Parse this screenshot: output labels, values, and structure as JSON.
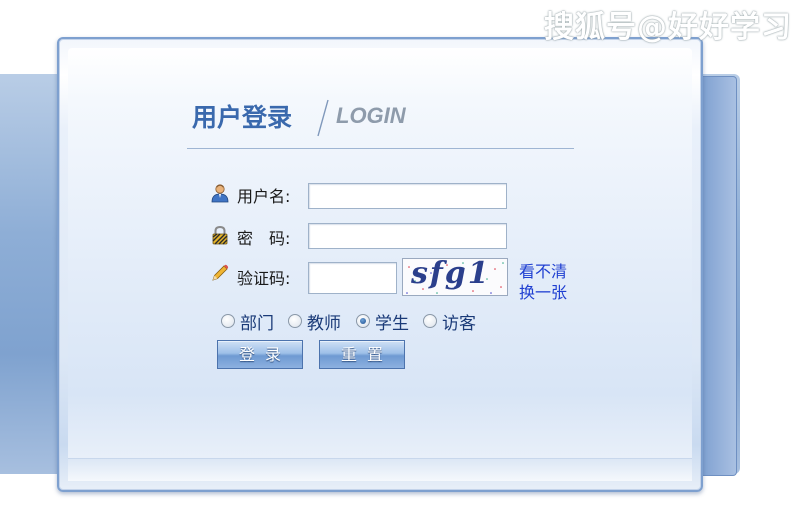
{
  "watermark": "搜狐号@好好学习",
  "login": {
    "title_cn": "用户登录",
    "title_en": "LOGIN",
    "username_label": "用户名:",
    "password_label": "密　码:",
    "captcha_label": "验证码:",
    "username_value": "",
    "password_value": "",
    "captcha_value": "",
    "captcha_image_text": "sfg1",
    "refresh_link_line1": "看不清",
    "refresh_link_line2": "换一张",
    "roles": [
      {
        "label": "部门",
        "checked": false
      },
      {
        "label": "教师",
        "checked": false
      },
      {
        "label": "学生",
        "checked": true
      },
      {
        "label": "访客",
        "checked": false
      }
    ],
    "login_button": "登录",
    "reset_button": "重置"
  },
  "colors": {
    "title_blue": "#3a69ad",
    "link_blue": "#1f3fd1",
    "button_blue": "#6f9ad2"
  }
}
